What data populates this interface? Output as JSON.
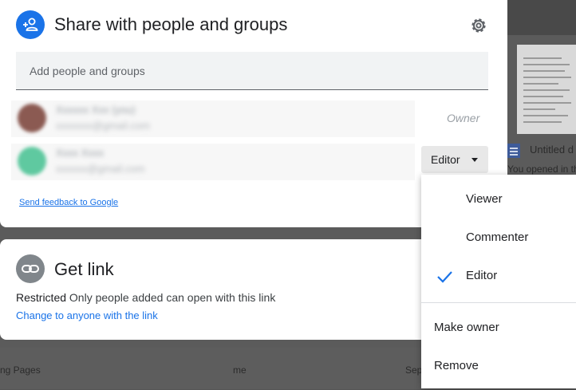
{
  "dialog": {
    "title": "Share with people and groups",
    "add_placeholder": "Add people and groups",
    "people": [
      {
        "name": "Xxxxxx Xxx (you)",
        "email": "xxxxxxx@gmail.com",
        "role": "Owner"
      },
      {
        "name": "Xxxx Xxxx",
        "email": "xxxxxx@gmail.com",
        "role": "Editor"
      }
    ],
    "feedback_link": "Send feedback to Google"
  },
  "link_card": {
    "title": "Get link",
    "restricted_label": "Restricted",
    "restricted_desc": "Only people added can open with this link",
    "change_link": "Change to anyone with the link"
  },
  "role_menu": {
    "items": [
      "Viewer",
      "Commenter",
      "Editor"
    ],
    "selected": "Editor",
    "actions": [
      "Make owner",
      "Remove"
    ]
  },
  "background": {
    "doc_title": "Untitled d",
    "opened_text": "You opened in th",
    "row_name": "ng Pages",
    "row_owner": "me",
    "row_date": "Sep"
  },
  "colors": {
    "accent": "#1a73e8",
    "share_icon_bg": "#1a73e8",
    "link_icon_bg": "#80868b"
  }
}
